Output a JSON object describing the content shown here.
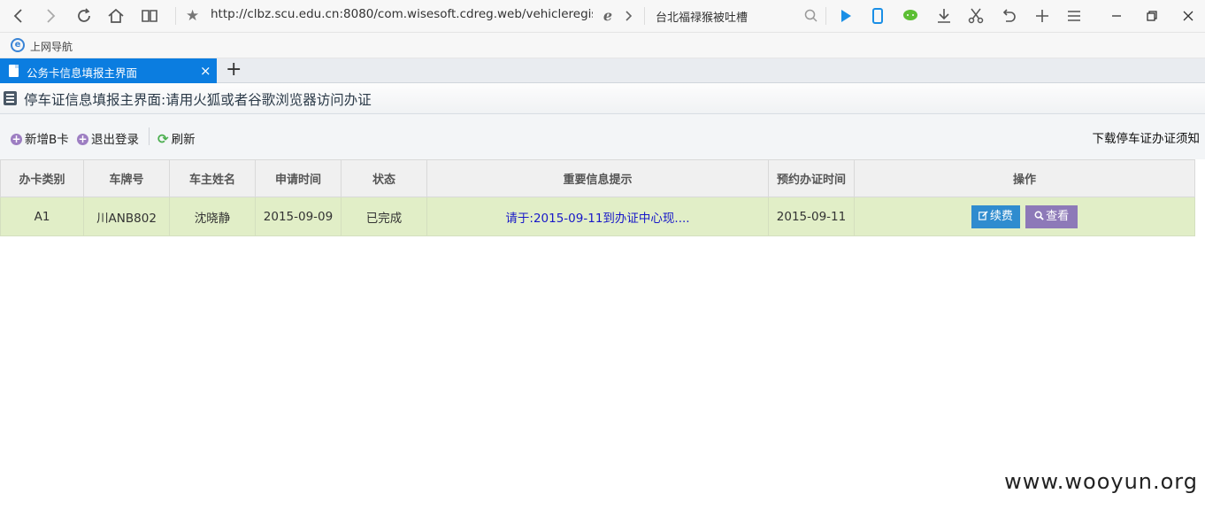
{
  "browser": {
    "address": "http://clbz.scu.edu.cn:8080/com.wisesoft.cdreg.web/vehicleregistratic",
    "search_text": "台北福禄猴被吐槽",
    "favorites_label": "上网导航",
    "tab_title": "公务卡信息填报主界面",
    "tab_close": "×",
    "new_tab": "+"
  },
  "page": {
    "title": "停车证信息填报主界面:请用火狐或者谷歌浏览器访问办证"
  },
  "actions": {
    "add_b_card": "新增B卡",
    "logout": "退出登录",
    "refresh": "刷新",
    "download_notice": "下载停车证办证须知"
  },
  "table": {
    "headers": [
      "办卡类别",
      "车牌号",
      "车主姓名",
      "申请时间",
      "状态",
      "重要信息提示",
      "预约办证时间",
      "操作"
    ],
    "rows": [
      {
        "card_type": "A1",
        "plate": "川ANB802",
        "owner": "沈晓静",
        "apply_date": "2015-09-09",
        "status": "已完成",
        "info": "请于:2015-09-11到办证中心现....",
        "appointment": "2015-09-11",
        "renew_label": "续费",
        "view_label": "查看"
      }
    ]
  },
  "watermark": "www.wooyun.org",
  "colors": {
    "tab_active": "#0b7de0",
    "row_bg": "#e1eec7",
    "renew_button": "#2f8ccf",
    "view_button": "#8d79b8",
    "info_link": "#1818c8"
  }
}
